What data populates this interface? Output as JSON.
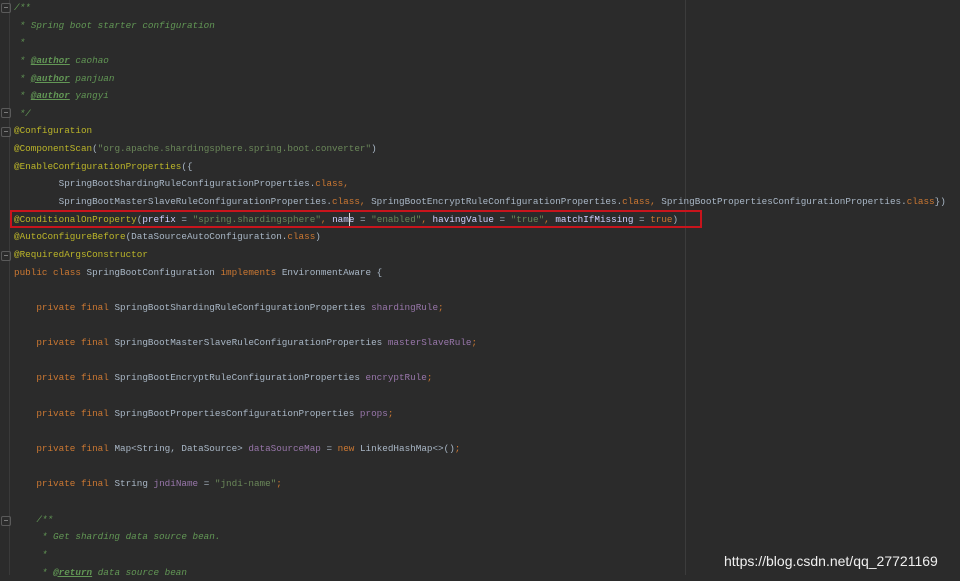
{
  "colors": {
    "background": "#2b2b2b",
    "comment": "#629755",
    "annotation": "#bbb529",
    "string": "#6a8759",
    "keyword": "#cc7832",
    "field": "#9876aa",
    "plain": "#a9b7c6",
    "highlight_box": "#c8141c"
  },
  "watermark": "https://blog.csdn.net/qq_27721169",
  "lines": [
    [
      [
        "comment",
        "/**"
      ]
    ],
    [
      [
        "comment",
        " * Spring boot starter configuration"
      ]
    ],
    [
      [
        "comment",
        " *"
      ]
    ],
    [
      [
        "comment",
        " * "
      ],
      [
        "tag",
        "@author"
      ],
      [
        "comment",
        " caohao"
      ]
    ],
    [
      [
        "comment",
        " * "
      ],
      [
        "tag",
        "@author"
      ],
      [
        "comment",
        " panjuan"
      ]
    ],
    [
      [
        "comment",
        " * "
      ],
      [
        "tag",
        "@author"
      ],
      [
        "comment",
        " yangyi"
      ]
    ],
    [
      [
        "comment",
        " */"
      ]
    ],
    [
      [
        "annotation",
        "@Configuration"
      ]
    ],
    [
      [
        "annotation",
        "@ComponentScan"
      ],
      [
        "plain",
        "("
      ],
      [
        "string",
        "\"org.apache.shardingsphere.spring.boot.converter\""
      ],
      [
        "plain",
        ")"
      ]
    ],
    [
      [
        "annotation",
        "@EnableConfigurationProperties"
      ],
      [
        "plain",
        "({"
      ]
    ],
    [
      [
        "plain",
        "        SpringBootShardingRuleConfigurationProperties."
      ],
      [
        "keyword",
        "class"
      ],
      [
        "keyword",
        ","
      ]
    ],
    [
      [
        "plain",
        "        SpringBootMasterSlaveRuleConfigurationProperties."
      ],
      [
        "keyword",
        "class"
      ],
      [
        "keyword",
        ", "
      ],
      [
        "plain",
        "SpringBootEncryptRuleConfigurationProperties."
      ],
      [
        "keyword",
        "class"
      ],
      [
        "keyword",
        ", "
      ],
      [
        "plain",
        "SpringBootPropertiesConfigurationProperties."
      ],
      [
        "keyword",
        "class"
      ],
      [
        "plain",
        "})"
      ]
    ],
    [
      [
        "annotation",
        "@ConditionalOnProperty"
      ],
      [
        "plain",
        "("
      ],
      [
        "param",
        "prefix"
      ],
      [
        "plain",
        " = "
      ],
      [
        "string",
        "\"spring.shardingsphere\""
      ],
      [
        "keyword",
        ", "
      ],
      [
        "param",
        "name"
      ],
      [
        "plain",
        " = "
      ],
      [
        "string",
        "\"enabled\""
      ],
      [
        "keyword",
        ", "
      ],
      [
        "param",
        "havingValue"
      ],
      [
        "plain",
        " = "
      ],
      [
        "string",
        "\"true\""
      ],
      [
        "keyword",
        ", "
      ],
      [
        "param",
        "matchIfMissing"
      ],
      [
        "plain",
        " = "
      ],
      [
        "keyword",
        "true"
      ],
      [
        "plain",
        ")"
      ]
    ],
    [
      [
        "annotation",
        "@AutoConfigureBefore"
      ],
      [
        "plain",
        "(DataSourceAutoConfiguration."
      ],
      [
        "keyword",
        "class"
      ],
      [
        "plain",
        ")"
      ]
    ],
    [
      [
        "annotation",
        "@RequiredArgsConstructor"
      ]
    ],
    [
      [
        "keyword",
        "public class "
      ],
      [
        "plain",
        "SpringBootConfiguration "
      ],
      [
        "keyword",
        "implements "
      ],
      [
        "plain",
        "EnvironmentAware {"
      ]
    ],
    [],
    [
      [
        "keyword",
        "    private final "
      ],
      [
        "plain",
        "SpringBootShardingRuleConfigurationProperties "
      ],
      [
        "field",
        "shardingRule"
      ],
      [
        "keyword",
        ";"
      ]
    ],
    [],
    [
      [
        "keyword",
        "    private final "
      ],
      [
        "plain",
        "SpringBootMasterSlaveRuleConfigurationProperties "
      ],
      [
        "field",
        "masterSlaveRule"
      ],
      [
        "keyword",
        ";"
      ]
    ],
    [],
    [
      [
        "keyword",
        "    private final "
      ],
      [
        "plain",
        "SpringBootEncryptRuleConfigurationProperties "
      ],
      [
        "field",
        "encryptRule"
      ],
      [
        "keyword",
        ";"
      ]
    ],
    [],
    [
      [
        "keyword",
        "    private final "
      ],
      [
        "plain",
        "SpringBootPropertiesConfigurationProperties "
      ],
      [
        "field",
        "props"
      ],
      [
        "keyword",
        ";"
      ]
    ],
    [],
    [
      [
        "keyword",
        "    private final "
      ],
      [
        "plain",
        "Map<String, DataSource> "
      ],
      [
        "field",
        "dataSourceMap"
      ],
      [
        "plain",
        " = "
      ],
      [
        "keyword",
        "new "
      ],
      [
        "plain",
        "LinkedHashMap<>()"
      ],
      [
        "keyword",
        ";"
      ]
    ],
    [],
    [
      [
        "keyword",
        "    private final "
      ],
      [
        "plain",
        "String "
      ],
      [
        "field",
        "jndiName"
      ],
      [
        "plain",
        " = "
      ],
      [
        "string",
        "\"jndi-name\""
      ],
      [
        "keyword",
        ";"
      ]
    ],
    [],
    [
      [
        "comment",
        "    /**"
      ]
    ],
    [
      [
        "comment",
        "     * Get sharding data source bean."
      ]
    ],
    [
      [
        "comment",
        "     *"
      ]
    ],
    [
      [
        "comment",
        "     * "
      ],
      [
        "tag",
        "@return"
      ],
      [
        "comment",
        " data source bean"
      ]
    ]
  ]
}
